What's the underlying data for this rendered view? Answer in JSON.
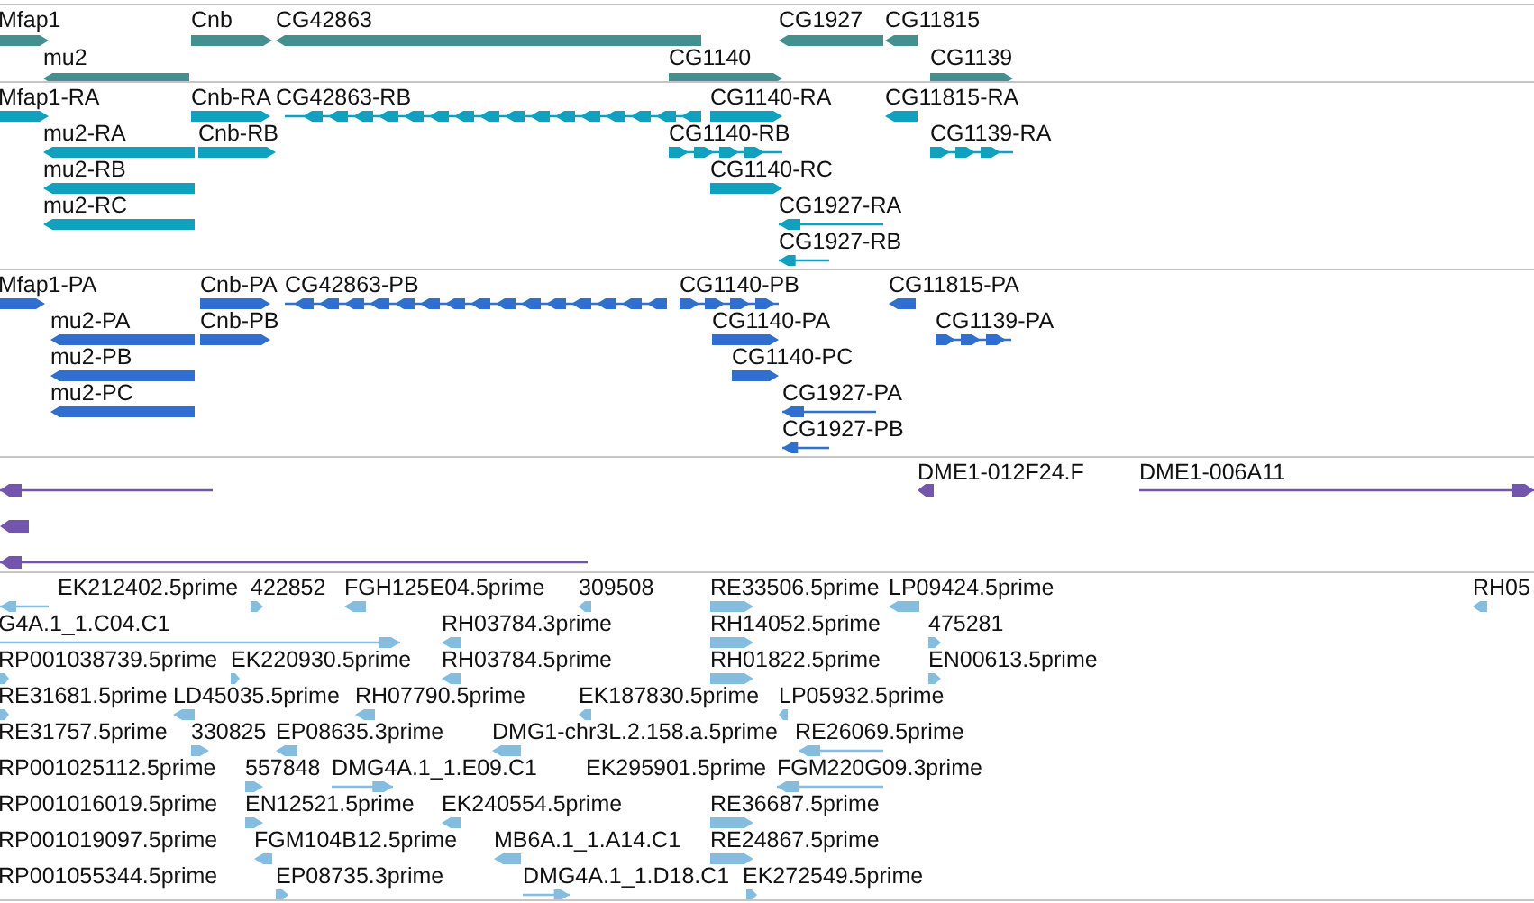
{
  "tracks": [
    {
      "kind": "gene",
      "features": [
        {
          "label": "Mfap1",
          "reverse": false
        },
        {
          "label": "Cnb",
          "reverse": false
        },
        {
          "label": "CG42863",
          "reverse": true
        },
        {
          "label": "CG1927",
          "reverse": true
        },
        {
          "label": "CG11815",
          "reverse": true
        },
        {
          "label": "mu2",
          "reverse": true
        },
        {
          "label": "CG1140",
          "reverse": false
        },
        {
          "label": "CG1139",
          "reverse": false
        }
      ]
    },
    {
      "kind": "transcript",
      "features": [
        {
          "label": "Mfap1-RA",
          "reverse": false
        },
        {
          "label": "Cnb-RA",
          "reverse": false
        },
        {
          "label": "CG42863-RB",
          "reverse": true
        },
        {
          "label": "CG1140-RA",
          "reverse": false
        },
        {
          "label": "CG11815-RA",
          "reverse": true
        },
        {
          "label": "mu2-RA",
          "reverse": true
        },
        {
          "label": "Cnb-RB",
          "reverse": false
        },
        {
          "label": "CG1140-RB",
          "reverse": false
        },
        {
          "label": "CG1139-RA",
          "reverse": false
        },
        {
          "label": "mu2-RB",
          "reverse": true
        },
        {
          "label": "CG1140-RC",
          "reverse": false
        },
        {
          "label": "mu2-RC",
          "reverse": true
        },
        {
          "label": "CG1927-RA",
          "reverse": true
        },
        {
          "label": "CG1927-RB",
          "reverse": true
        }
      ]
    },
    {
      "kind": "protein",
      "features": [
        {
          "label": "Mfap1-PA",
          "reverse": false
        },
        {
          "label": "Cnb-PA",
          "reverse": false
        },
        {
          "label": "CG42863-PB",
          "reverse": true
        },
        {
          "label": "CG1140-PB",
          "reverse": false
        },
        {
          "label": "CG11815-PA",
          "reverse": true
        },
        {
          "label": "mu2-PA",
          "reverse": true
        },
        {
          "label": "Cnb-PB",
          "reverse": false
        },
        {
          "label": "CG1140-PA",
          "reverse": false
        },
        {
          "label": "CG1139-PA",
          "reverse": false
        },
        {
          "label": "mu2-PB",
          "reverse": true
        },
        {
          "label": "CG1140-PC",
          "reverse": false
        },
        {
          "label": "mu2-PC",
          "reverse": true
        },
        {
          "label": "CG1927-PA",
          "reverse": true
        },
        {
          "label": "CG1927-PB",
          "reverse": true
        }
      ]
    },
    {
      "kind": "clone",
      "features": [
        {
          "reverse": true
        },
        {
          "label": "DME1-012F24.F",
          "reverse": true
        },
        {
          "label": "DME1-006A11",
          "reverse": false
        },
        {
          "reverse": true
        },
        {
          "reverse": true
        }
      ]
    },
    {
      "kind": "est",
      "features": [
        {
          "reverse": true
        },
        {
          "label": "EK212402.5prime"
        },
        {
          "label": "422852",
          "reverse": false
        },
        {
          "label": "FGH125E04.5prime",
          "reverse": true
        },
        {
          "label": "309508",
          "reverse": true
        },
        {
          "label": "RE33506.5prime",
          "reverse": false
        },
        {
          "label": "LP09424.5prime",
          "reverse": true
        },
        {
          "label": "RH05",
          "reverse": true
        },
        {
          "label": "G4A.1_1.C04.C1",
          "reverse": false
        },
        {
          "label": "RH03784.3prime",
          "reverse": true
        },
        {
          "label": "RH14052.5prime",
          "reverse": false
        },
        {
          "label": "475281",
          "reverse": false
        },
        {
          "label": "RP001038739.5prime",
          "reverse": false
        },
        {
          "label": "EK220930.5prime",
          "reverse": false
        },
        {
          "label": "RH03784.5prime",
          "reverse": true
        },
        {
          "label": "RH01822.5prime",
          "reverse": false
        },
        {
          "label": "EN00613.5prime",
          "reverse": false
        },
        {
          "label": "RE31681.5prime",
          "reverse": false
        },
        {
          "label": "LD45035.5prime",
          "reverse": true
        },
        {
          "label": "RH07790.5prime",
          "reverse": true
        },
        {
          "label": "EK187830.5prime",
          "reverse": true
        },
        {
          "label": "LP05932.5prime",
          "reverse": true
        },
        {
          "label": "RE31757.5prime"
        },
        {
          "label": "330825",
          "reverse": false
        },
        {
          "label": "EP08635.3prime",
          "reverse": true
        },
        {
          "label": "DMG1-chr3L.2.158.a.5prime",
          "reverse": true
        },
        {
          "label": "RE26069.5prime",
          "reverse": true
        },
        {
          "label": "RP001025112.5prime"
        },
        {
          "label": "557848",
          "reverse": false
        },
        {
          "label": "DMG4A.1_1.E09.C1",
          "reverse": false
        },
        {
          "label": "EK295901.5prime"
        },
        {
          "label": "FGM220G09.3prime",
          "reverse": true
        },
        {
          "label": "RP001016019.5prime"
        },
        {
          "label": "EN12521.5prime",
          "reverse": false
        },
        {
          "label": "EK240554.5prime",
          "reverse": true
        },
        {
          "label": "RE36687.5prime",
          "reverse": false
        },
        {
          "label": "RP001019097.5prime"
        },
        {
          "label": "FGM104B12.5prime",
          "reverse": true
        },
        {
          "label": "MB6A.1_1.A14.C1",
          "reverse": true
        },
        {
          "label": "RE24867.5prime",
          "reverse": false
        },
        {
          "label": "RP001055344.5prime"
        },
        {
          "label": "EP08735.3prime",
          "reverse": false
        },
        {
          "label": "DMG4A.1_1.D18.C1",
          "reverse": false
        },
        {
          "label": "EK272549.5prime",
          "reverse": false
        }
      ]
    }
  ]
}
